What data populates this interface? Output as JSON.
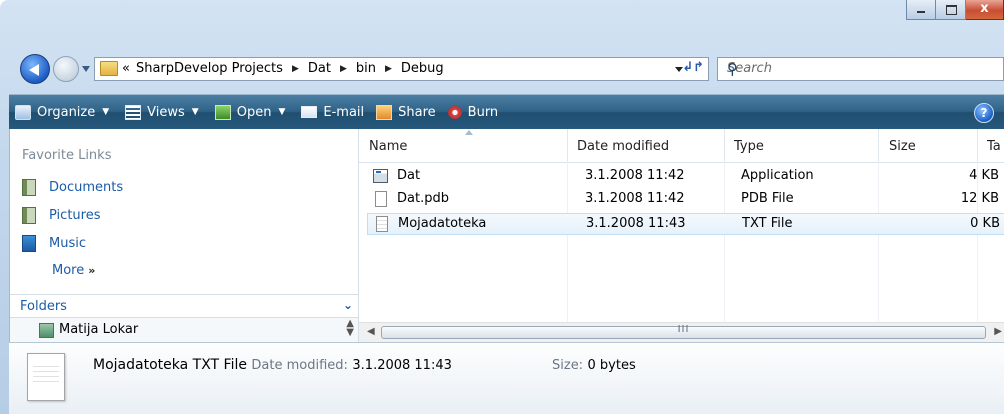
{
  "address": {
    "overflow": "«",
    "crumbs": [
      "SharpDevelop Projects",
      "Dat",
      "bin",
      "Debug"
    ]
  },
  "search": {
    "placeholder": "Search"
  },
  "toolbar": {
    "organize": "Organize",
    "views": "Views",
    "open": "Open",
    "email": "E-mail",
    "share": "Share",
    "burn": "Burn",
    "help": "?"
  },
  "nav": {
    "favorites_title": "Favorite Links",
    "links": [
      "Documents",
      "Pictures",
      "Music"
    ],
    "more": "More",
    "folders": "Folders",
    "tree_item": "Matija Lokar"
  },
  "list": {
    "columns": [
      "Name",
      "Date modified",
      "Type",
      "Size",
      "Ta"
    ],
    "rows": [
      {
        "name": "Dat",
        "date": "3.1.2008 11:42",
        "type": "Application",
        "size": "4 KB",
        "icon": "application-icon"
      },
      {
        "name": "Dat.pdb",
        "date": "3.1.2008 11:42",
        "type": "PDB File",
        "size": "12 KB",
        "icon": "pdb-file-icon"
      },
      {
        "name": "Mojadatoteka",
        "date": "3.1.2008 11:43",
        "type": "TXT File",
        "size": "0 KB",
        "icon": "text-file-icon",
        "selected": true
      }
    ],
    "scroll_grip": "III"
  },
  "details": {
    "name": "Mojadatoteka",
    "type": "TXT File",
    "date_label": "Date modified:",
    "date_value": "3.1.2008 11:43",
    "size_label": "Size:",
    "size_value": "0 bytes"
  },
  "window": {
    "close_glyph": "x"
  }
}
